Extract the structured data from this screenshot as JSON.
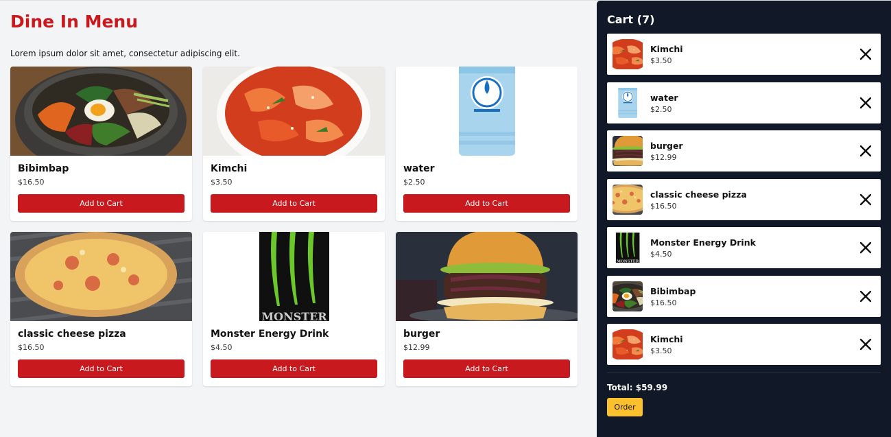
{
  "menu": {
    "title": "Dine In Menu",
    "subtitle": "Lorem ipsum dolor sit amet, consectetur adipiscing elit.",
    "add_label": "Add to Cart",
    "items": [
      {
        "name": "Bibimbap",
        "price": "$16.50",
        "image": "bibimbap"
      },
      {
        "name": "Kimchi",
        "price": "$3.50",
        "image": "kimchi"
      },
      {
        "name": "water",
        "price": "$2.50",
        "image": "water-bottle"
      },
      {
        "name": "classic cheese pizza",
        "price": "$16.50",
        "image": "pizza"
      },
      {
        "name": "Monster Energy Drink",
        "price": "$4.50",
        "image": "monster-can"
      },
      {
        "name": "burger",
        "price": "$12.99",
        "image": "burger"
      }
    ]
  },
  "cart": {
    "title": "Cart (7)",
    "items": [
      {
        "name": "Kimchi",
        "price": "$3.50",
        "image": "kimchi"
      },
      {
        "name": "water",
        "price": "$2.50",
        "image": "water-bottle"
      },
      {
        "name": "burger",
        "price": "$12.99",
        "image": "burger"
      },
      {
        "name": "classic cheese pizza",
        "price": "$16.50",
        "image": "pizza"
      },
      {
        "name": "Monster Energy Drink",
        "price": "$4.50",
        "image": "monster-can"
      },
      {
        "name": "Bibimbap",
        "price": "$16.50",
        "image": "bibimbap"
      },
      {
        "name": "Kimchi",
        "price": "$3.50",
        "image": "kimchi"
      }
    ],
    "total": "Total: $59.99",
    "order_label": "Order"
  },
  "colors": {
    "accent": "#c8191e",
    "cart_bg": "#111827",
    "order_button": "#fbc02d",
    "page_bg": "#f3f4f6"
  },
  "icons": {
    "remove": "close-icon"
  }
}
